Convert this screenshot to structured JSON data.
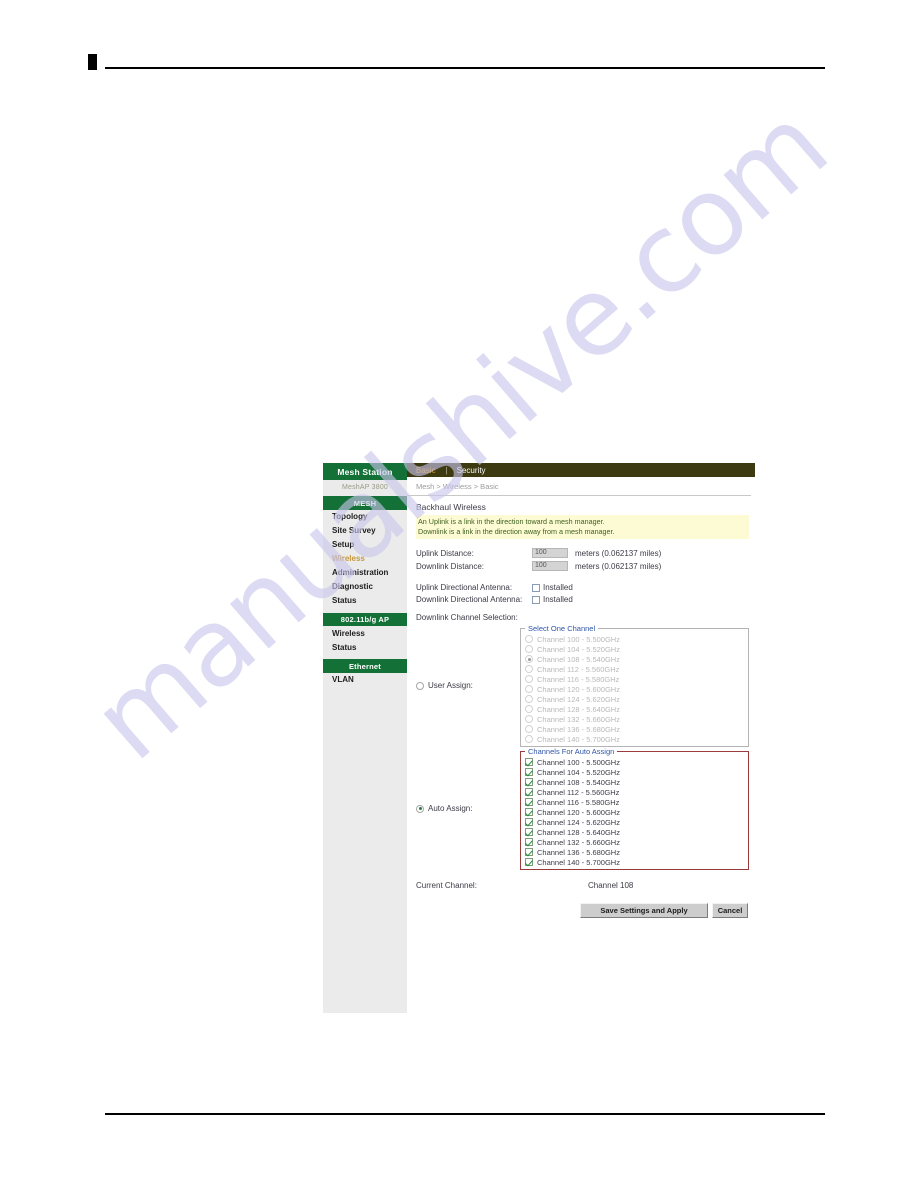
{
  "device": {
    "brand": "Mesh Station",
    "model": "MeshAP 3800"
  },
  "tabs": [
    {
      "label": "Basic",
      "active": true
    },
    {
      "label": "Security",
      "active": false
    }
  ],
  "tab_separator": "|",
  "breadcrumb": "Mesh > Wireless > Basic",
  "sidebar": {
    "groups": [
      {
        "title": "MESH",
        "items": [
          {
            "label": "Topology",
            "active": false
          },
          {
            "label": "Site Survey",
            "active": false
          },
          {
            "label": "Setup",
            "active": false
          },
          {
            "label": "Wireless",
            "active": true
          },
          {
            "label": "Administration",
            "active": false
          },
          {
            "label": "Diagnostic",
            "active": false
          },
          {
            "label": "Status",
            "active": false
          }
        ]
      },
      {
        "title": "802.11b/g AP",
        "items": [
          {
            "label": "Wireless",
            "active": false
          },
          {
            "label": "Status",
            "active": false
          }
        ]
      },
      {
        "title": "Ethernet",
        "items": [
          {
            "label": "VLAN",
            "active": false
          }
        ]
      }
    ]
  },
  "main": {
    "section_title": "Backhaul Wireless",
    "notice_line1": "An Uplink is a link in the direction toward a mesh manager.",
    "notice_line2": "Downlink is a link in the direction away from a mesh manager.",
    "uplink_distance_label": "Uplink Distance:",
    "uplink_distance_value": "100",
    "uplink_distance_suffix": "meters (0.062137 miles)",
    "downlink_distance_label": "Downlink Distance:",
    "downlink_distance_value": "100",
    "downlink_distance_suffix": "meters (0.062137 miles)",
    "uplink_antenna_label": "Uplink Directional Antenna:",
    "uplink_antenna_checkbox_label": "Installed",
    "uplink_antenna_checked": false,
    "downlink_antenna_label": "Downlink Directional Antenna:",
    "downlink_antenna_checkbox_label": "Installed",
    "downlink_antenna_checked": false,
    "channel_selection_label": "Downlink Channel Selection:",
    "user_assign_label": "User Assign:",
    "user_assign_selected": false,
    "auto_assign_label": "Auto Assign:",
    "auto_assign_selected": true,
    "select_one_channel_legend": "Select One Channel",
    "channels_for_auto_assign_legend": "Channels For Auto Assign",
    "select_one_channel": [
      {
        "label": "Channel 100 - 5.500GHz",
        "selected": false
      },
      {
        "label": "Channel 104 - 5.520GHz",
        "selected": false
      },
      {
        "label": "Channel 108 - 5.540GHz",
        "selected": true
      },
      {
        "label": "Channel 112 - 5.560GHz",
        "selected": false
      },
      {
        "label": "Channel 116 - 5.580GHz",
        "selected": false
      },
      {
        "label": "Channel 120 - 5.600GHz",
        "selected": false
      },
      {
        "label": "Channel 124 - 5.620GHz",
        "selected": false
      },
      {
        "label": "Channel 128 - 5.640GHz",
        "selected": false
      },
      {
        "label": "Channel 132 - 5.660GHz",
        "selected": false
      },
      {
        "label": "Channel 136 - 5.680GHz",
        "selected": false
      },
      {
        "label": "Channel 140 - 5.700GHz",
        "selected": false
      }
    ],
    "auto_assign_channels": [
      {
        "label": "Channel 100 - 5.500GHz",
        "checked": true
      },
      {
        "label": "Channel 104 - 5.520GHz",
        "checked": true
      },
      {
        "label": "Channel 108 - 5.540GHz",
        "checked": true
      },
      {
        "label": "Channel 112 - 5.560GHz",
        "checked": true
      },
      {
        "label": "Channel 116 - 5.580GHz",
        "checked": true
      },
      {
        "label": "Channel 120 - 5.600GHz",
        "checked": true
      },
      {
        "label": "Channel 124 - 5.620GHz",
        "checked": true
      },
      {
        "label": "Channel 128 - 5.640GHz",
        "checked": true
      },
      {
        "label": "Channel 132 - 5.660GHz",
        "checked": true
      },
      {
        "label": "Channel 136 - 5.680GHz",
        "checked": true
      },
      {
        "label": "Channel 140 - 5.700GHz",
        "checked": true
      }
    ],
    "current_channel_label": "Current Channel:",
    "current_channel_value": "Channel 108",
    "save_button": "Save Settings and Apply",
    "cancel_button": "Cancel"
  },
  "watermark": {
    "text": "manualshive.com"
  },
  "colors": {
    "sidebar_green": "#137036",
    "tabbar_olive": "#3d3a11",
    "active_tab_gold": "#d8941c",
    "active_link_gold": "#c59a3f",
    "notice_yellow": "#fdfbd3",
    "notice_text": "#3f6020",
    "legend_blue": "#2f55a8",
    "auto_box_red": "#9c3b3b",
    "checkbox_green": "#1e8a34"
  }
}
